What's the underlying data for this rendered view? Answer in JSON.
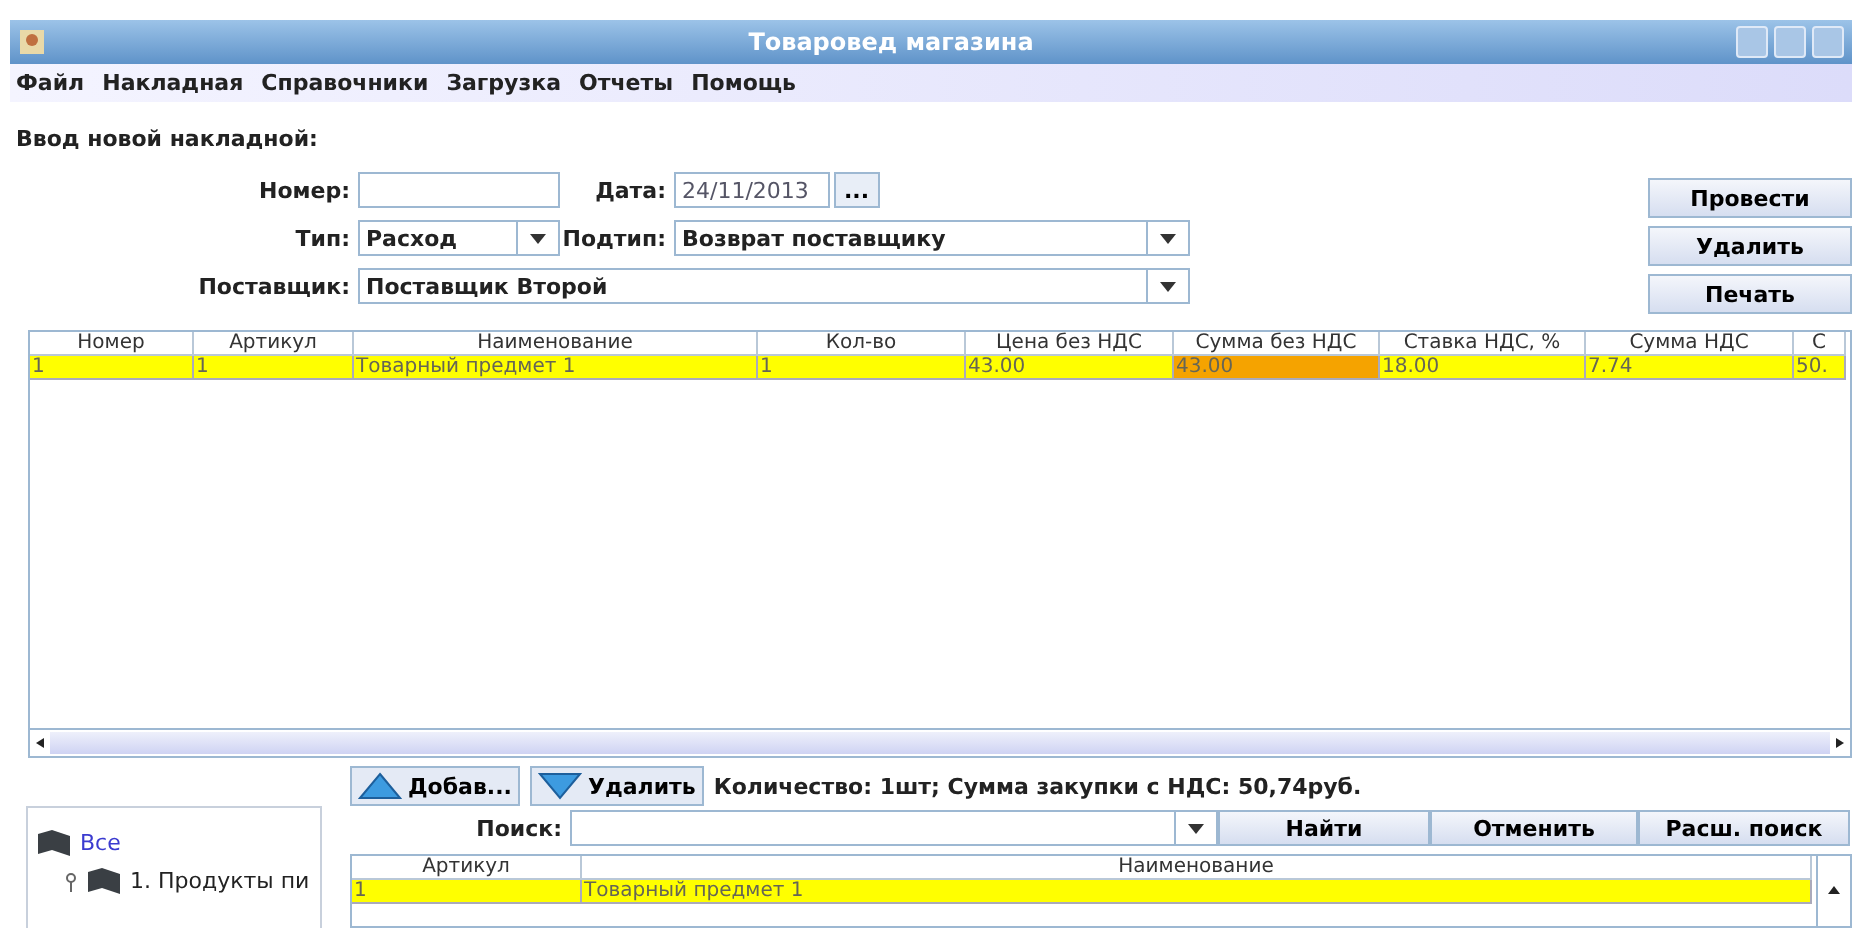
{
  "window": {
    "title": "Товаровед магазина"
  },
  "menu": [
    "Файл",
    "Накладная",
    "Справочники",
    "Загрузка",
    "Отчеты",
    "Помощь"
  ],
  "form": {
    "heading": "Ввод новой накладной:",
    "number": {
      "label": "Номер:"
    },
    "date": {
      "label": "Дата:",
      "value": "24/11/2013",
      "button": "..."
    },
    "type": {
      "label": "Тип:",
      "value": "Расход"
    },
    "subtype": {
      "label": "Подтип:",
      "value": "Возврат поставщику"
    },
    "supplier": {
      "label": "Поставщик:",
      "value": "Поставщик Второй"
    }
  },
  "actions": [
    "Провести",
    "Удалить",
    "Печать"
  ],
  "table": {
    "columns": [
      "Номер",
      "Артикул",
      "Наименование",
      "Кол-во",
      "Цена без НДС",
      "Сумма без НДС",
      "Ставка НДС, %",
      "Сумма НДС",
      "С"
    ],
    "rows": [
      {
        "selected": true,
        "cells": [
          {
            "text": "1",
            "focused": false
          },
          {
            "text": "1",
            "focused": false
          },
          {
            "text": "Товарный предмет 1",
            "focused": false
          },
          {
            "text": "1",
            "focused": false
          },
          {
            "text": "43.00",
            "focused": false
          },
          {
            "text": "43.00",
            "focused": true
          },
          {
            "text": "18.00",
            "focused": false
          },
          {
            "text": "7.74",
            "focused": false
          },
          {
            "text": "50.",
            "focused": false
          }
        ]
      }
    ]
  },
  "row_buttons": [
    {
      "label": "Добав...",
      "kind": "add"
    },
    {
      "label": "Удалить",
      "kind": "remove"
    }
  ],
  "summary": "Количество: 1шт; Сумма закупки с НДС: 50,74руб.",
  "tree": [
    {
      "label": "Все",
      "children": [
        {
          "label": "1. Продукты пи",
          "expanded": true
        }
      ]
    }
  ],
  "search": {
    "label": "Поиск:",
    "buttons": [
      "Найти",
      "Отменить",
      "Расш. поиск"
    ]
  },
  "products": {
    "columns": [
      "Артикул",
      "Наименование"
    ],
    "rows": [
      {
        "selected": true,
        "cells": [
          "1",
          "Товарный предмет 1"
        ]
      }
    ]
  }
}
